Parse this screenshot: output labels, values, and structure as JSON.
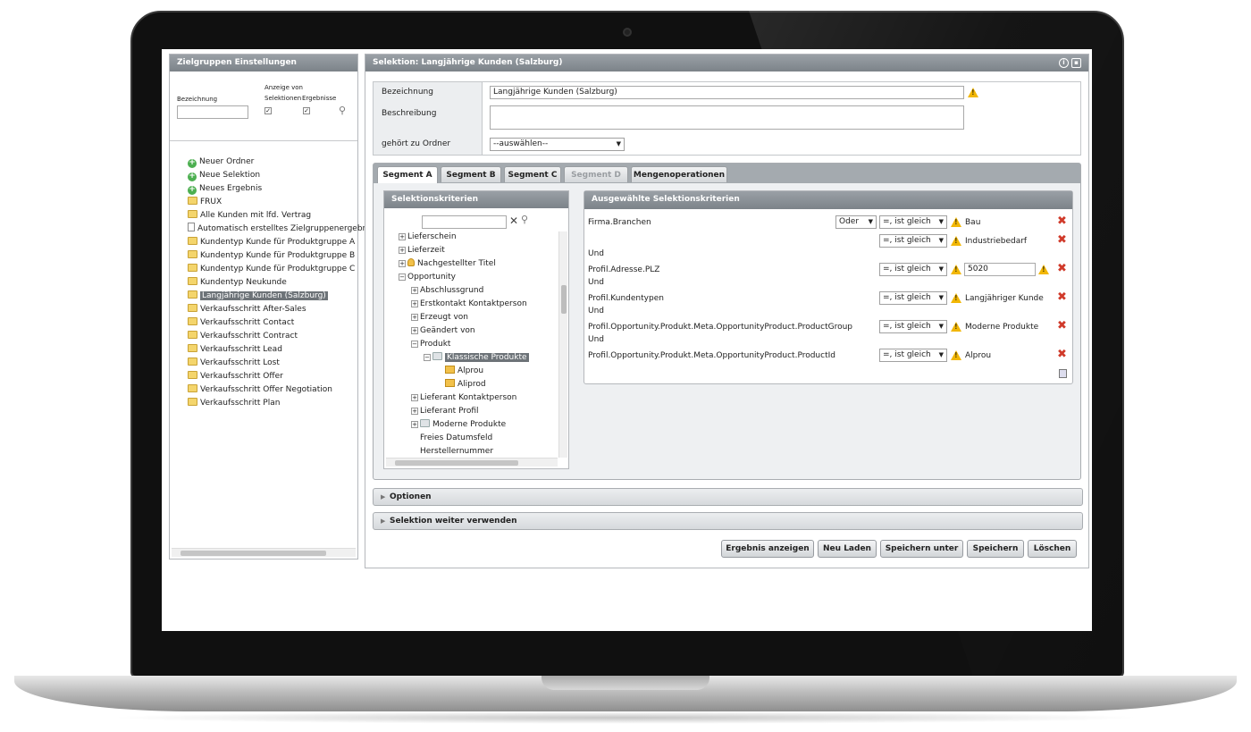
{
  "left_panel": {
    "title": "Zielgruppen Einstellungen",
    "filter": {
      "bezeichnung_label": "Bezeichnung",
      "anzeige_label": "Anzeige von",
      "selektionen_label": "Selektionen",
      "ergebnisse_label": "Ergebnisse",
      "bezeichnung_value": "",
      "selektionen_checked": true,
      "ergebnisse_checked": true
    },
    "tree": [
      {
        "label": "Neuer Ordner",
        "icon": "add-icon"
      },
      {
        "label": "Neue Selektion",
        "icon": "add-icon"
      },
      {
        "label": "Neues Ergebnis",
        "icon": "add-icon"
      },
      {
        "label": "FRUX",
        "icon": "folder-icon"
      },
      {
        "label": "Alle Kunden mit lfd. Vertrag",
        "icon": "selection-icon"
      },
      {
        "label": "Automatisch erstelltes Zielgruppenergebnis",
        "icon": "document-icon"
      },
      {
        "label": "Kundentyp Kunde für Produktgruppe A",
        "icon": "selection-icon"
      },
      {
        "label": "Kundentyp Kunde für Produktgruppe B",
        "icon": "selection-icon"
      },
      {
        "label": "Kundentyp Kunde für Produktgruppe C",
        "icon": "selection-icon"
      },
      {
        "label": "Kundentyp Neukunde",
        "icon": "selection-icon"
      },
      {
        "label": "Langjährige Kunden (Salzburg)",
        "icon": "selection-icon",
        "selected": true
      },
      {
        "label": "Verkaufsschritt After-Sales",
        "icon": "selection-icon"
      },
      {
        "label": "Verkaufsschritt Contact",
        "icon": "selection-icon"
      },
      {
        "label": "Verkaufsschritt Contract",
        "icon": "selection-icon"
      },
      {
        "label": "Verkaufsschritt Lead",
        "icon": "selection-icon"
      },
      {
        "label": "Verkaufsschritt Lost",
        "icon": "selection-icon"
      },
      {
        "label": "Verkaufsschritt Offer",
        "icon": "selection-icon"
      },
      {
        "label": "Verkaufsschritt Offer Negotiation",
        "icon": "selection-icon"
      },
      {
        "label": "Verkaufsschritt Plan",
        "icon": "selection-icon"
      }
    ]
  },
  "main_panel": {
    "title": "Selektion: Langjährige Kunden (Salzburg)",
    "form": {
      "bezeichnung_label": "Bezeichnung",
      "bezeichnung_value": "Langjährige Kunden (Salzburg)",
      "beschreibung_label": "Beschreibung",
      "beschreibung_value": "",
      "ordner_label": "gehört zu Ordner",
      "ordner_value": "--auswählen--"
    },
    "tabs": [
      {
        "label": "Segment A",
        "state": "active"
      },
      {
        "label": "Segment B",
        "state": "normal"
      },
      {
        "label": "Segment C",
        "state": "normal"
      },
      {
        "label": "Segment D",
        "state": "disabled"
      },
      {
        "label": "Mengenoperationen",
        "state": "normal"
      }
    ],
    "criteria_tree": {
      "title": "Selektionskriterien",
      "search_value": "",
      "items": [
        {
          "label": "Lieferschein",
          "expander": "+",
          "level": 0
        },
        {
          "label": "Lieferzeit",
          "expander": "+",
          "level": 0
        },
        {
          "label": "Nachgestellter Titel",
          "expander": "+",
          "level": 0,
          "icon": "person-icon"
        },
        {
          "label": "Opportunity",
          "expander": "-",
          "level": 0
        },
        {
          "label": "Abschlussgrund",
          "expander": "+",
          "level": 1
        },
        {
          "label": "Erstkontakt Kontaktperson",
          "expander": "+",
          "level": 1
        },
        {
          "label": "Erzeugt von",
          "expander": "+",
          "level": 1
        },
        {
          "label": "Geändert von",
          "expander": "+",
          "level": 1
        },
        {
          "label": "Produkt",
          "expander": "-",
          "level": 1
        },
        {
          "label": "Klassische Produkte",
          "expander": "-",
          "level": 2,
          "icon": "package-group-icon",
          "selected": true
        },
        {
          "label": "Alprou",
          "expander": "",
          "level": 3,
          "icon": "box-icon"
        },
        {
          "label": "Aliprod",
          "expander": "",
          "level": 3,
          "icon": "box-icon"
        },
        {
          "label": "Lieferant Kontaktperson",
          "expander": "+",
          "level": 1
        },
        {
          "label": "Lieferant Profil",
          "expander": "+",
          "level": 1
        },
        {
          "label": "Moderne Produkte",
          "expander": "+",
          "level": 1,
          "icon": "package-group-icon"
        },
        {
          "label": "Freies Datumsfeld",
          "expander": "",
          "level": 1
        },
        {
          "label": "Herstellernummer",
          "expander": "",
          "level": 1
        }
      ]
    },
    "selected_criteria": {
      "title": "Ausgewählte Selektionskriterien",
      "and_label": "Und",
      "rows": [
        {
          "field": "Firma.Branchen",
          "conjunction": "Oder",
          "operator": "=, ist gleich",
          "value": "Bau",
          "value_type": "text"
        },
        {
          "field": "",
          "conjunction": "",
          "operator": "=, ist gleich",
          "value": "Industriebedarf",
          "value_type": "text"
        },
        {
          "field": "Profil.Adresse.PLZ",
          "conjunction": "",
          "operator": "=, ist gleich",
          "value": "5020",
          "value_type": "input"
        },
        {
          "field": "Profil.Kundentypen",
          "conjunction": "",
          "operator": "=, ist gleich",
          "value": "Langjähriger Kunde",
          "value_type": "text"
        },
        {
          "field": "Profil.Opportunity.Produkt.Meta.OpportunityProduct.ProductGroup",
          "conjunction": "",
          "operator": "=, ist gleich",
          "value": "Moderne Produkte",
          "value_type": "text"
        },
        {
          "field": "Profil.Opportunity.Produkt.Meta.OpportunityProduct.ProductId",
          "conjunction": "",
          "operator": "=, ist gleich",
          "value": "Alprou",
          "value_type": "text"
        }
      ]
    },
    "accordions": [
      "Optionen",
      "Selektion weiter verwenden"
    ],
    "buttons": [
      "Ergebnis anzeigen",
      "Neu Laden",
      "Speichern unter",
      "Speichern",
      "Löschen"
    ]
  },
  "colors": {
    "header_bg": "#7c8389",
    "selection_bg": "#6d7378",
    "warning": "#f2b705",
    "delete": "#d03a2a"
  }
}
